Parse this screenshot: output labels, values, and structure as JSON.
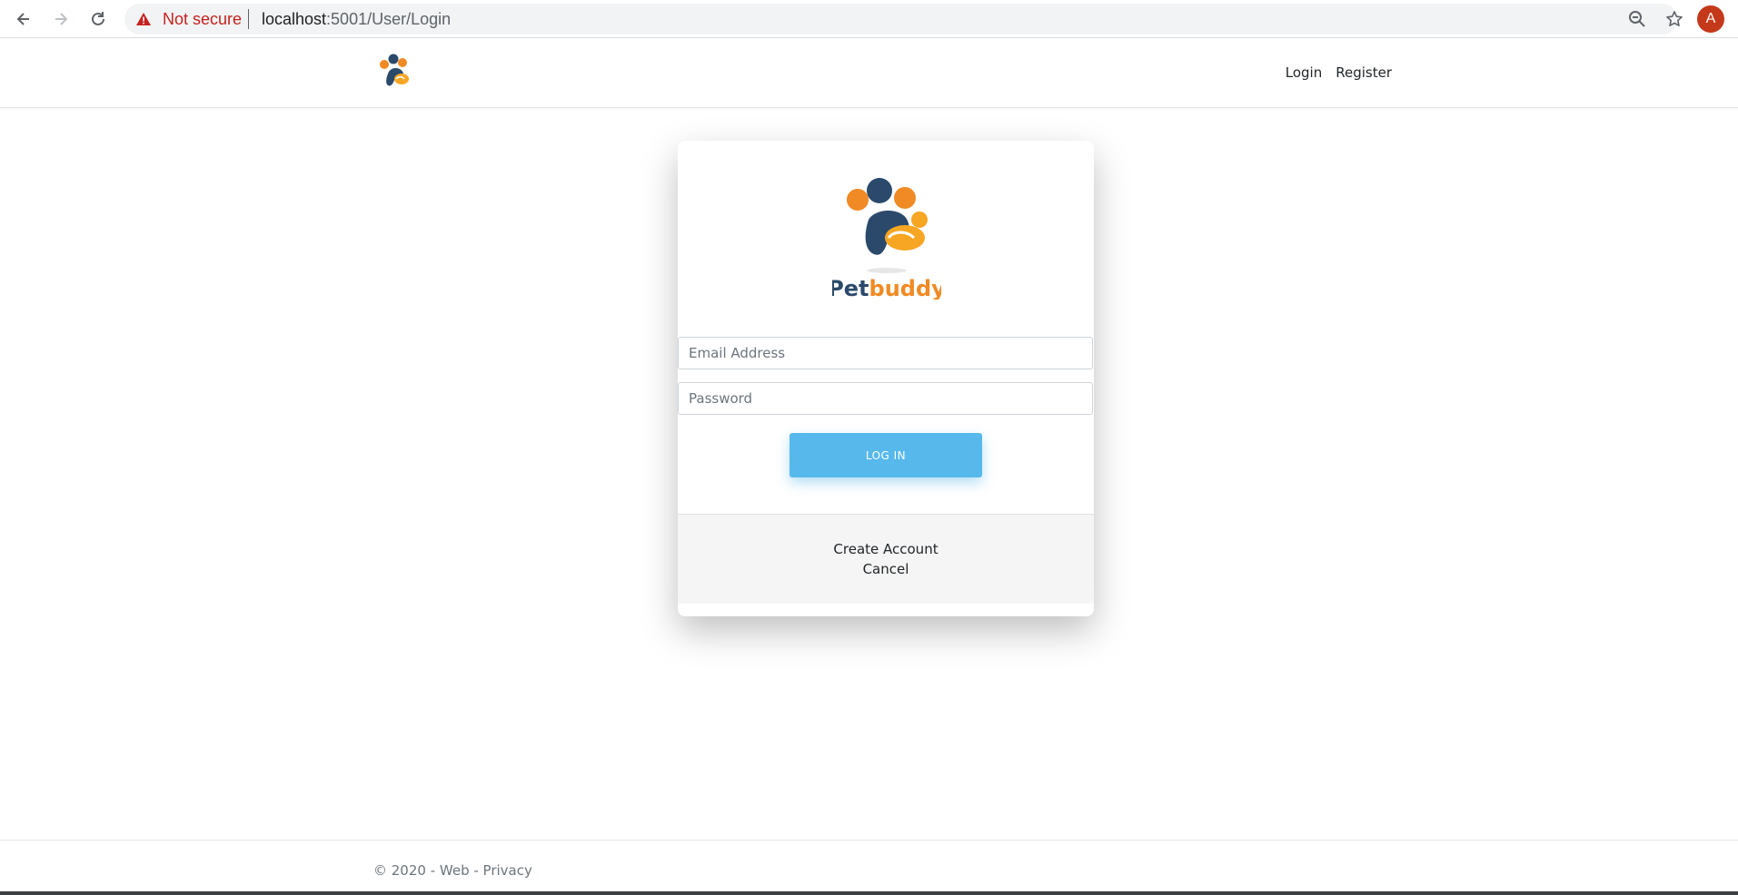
{
  "browser": {
    "security_label": "Not secure",
    "url_host": "localhost",
    "url_path": ":5001/User/Login",
    "avatar_letter": "A",
    "colors": {
      "warning": "#c5221f",
      "avatar": "#c5391b"
    }
  },
  "header": {
    "nav": [
      {
        "label": "Login"
      },
      {
        "label": "Register"
      }
    ]
  },
  "login": {
    "brand_part1": "Pet",
    "brand_part2": "buddy",
    "email_placeholder": "Email Address",
    "password_placeholder": "Password",
    "login_button": "LOG IN",
    "create_account": "Create Account",
    "cancel": "Cancel",
    "colors": {
      "button": "#57b8ec",
      "brand_dark": "#2b4a6b",
      "brand_orange": "#f08a24"
    }
  },
  "footer": {
    "copyright": "© 2020 - Web - ",
    "privacy": "Privacy"
  }
}
